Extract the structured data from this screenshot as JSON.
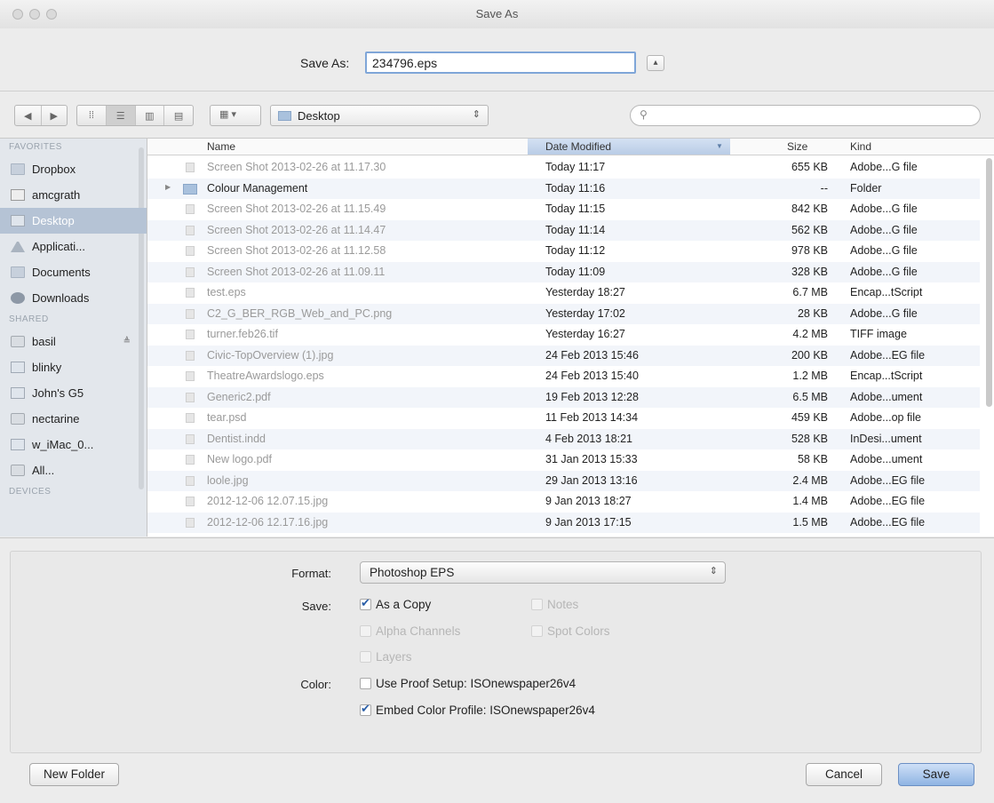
{
  "window": {
    "title": "Save As"
  },
  "save_row": {
    "label": "Save As:",
    "filename": "234796.eps",
    "expand_glyph": "▴"
  },
  "toolbar": {
    "location": "Desktop",
    "search_placeholder": ""
  },
  "sidebar": {
    "sections": [
      {
        "header": "FAVORITES",
        "items": [
          {
            "label": "Dropbox",
            "icon": "folder-icon"
          },
          {
            "label": "amcgrath",
            "icon": "home-icon"
          },
          {
            "label": "Desktop",
            "icon": "desktop-icon",
            "selected": true
          },
          {
            "label": "Applicati...",
            "icon": "applications-icon"
          },
          {
            "label": "Documents",
            "icon": "documents-icon"
          },
          {
            "label": "Downloads",
            "icon": "downloads-icon"
          }
        ]
      },
      {
        "header": "SHARED",
        "items": [
          {
            "label": "basil",
            "icon": "server-icon",
            "eject": "≜"
          },
          {
            "label": "blinky",
            "icon": "computer-icon"
          },
          {
            "label": "John's G5",
            "icon": "computer-icon"
          },
          {
            "label": "nectarine",
            "icon": "server-icon"
          },
          {
            "label": "w_iMac_0...",
            "icon": "computer-icon"
          },
          {
            "label": "All...",
            "icon": "network-icon"
          }
        ]
      },
      {
        "header": "DEVICES",
        "items": []
      }
    ]
  },
  "file_list": {
    "columns": [
      "Name",
      "Date Modified",
      "Size",
      "Kind"
    ],
    "rows": [
      {
        "name": "Screen Shot 2013-02-26 at 11.17.30",
        "date": "Today 11:17",
        "size": "655 KB",
        "kind": "Adobe...G file",
        "enabled": false
      },
      {
        "name": "Colour Management",
        "date": "Today 11:16",
        "size": "--",
        "kind": "Folder",
        "enabled": true,
        "folder": true
      },
      {
        "name": "Screen Shot 2013-02-26 at 11.15.49",
        "date": "Today 11:15",
        "size": "842 KB",
        "kind": "Adobe...G file",
        "enabled": false
      },
      {
        "name": "Screen Shot 2013-02-26 at 11.14.47",
        "date": "Today 11:14",
        "size": "562 KB",
        "kind": "Adobe...G file",
        "enabled": false
      },
      {
        "name": "Screen Shot 2013-02-26 at 11.12.58",
        "date": "Today 11:12",
        "size": "978 KB",
        "kind": "Adobe...G file",
        "enabled": false
      },
      {
        "name": "Screen Shot 2013-02-26 at 11.09.11",
        "date": "Today 11:09",
        "size": "328 KB",
        "kind": "Adobe...G file",
        "enabled": false
      },
      {
        "name": "test.eps",
        "date": "Yesterday 18:27",
        "size": "6.7 MB",
        "kind": "Encap...tScript",
        "enabled": false
      },
      {
        "name": "C2_G_BER_RGB_Web_and_PC.png",
        "date": "Yesterday 17:02",
        "size": "28 KB",
        "kind": "Adobe...G file",
        "enabled": false
      },
      {
        "name": "turner.feb26.tif",
        "date": "Yesterday 16:27",
        "size": "4.2 MB",
        "kind": "TIFF image",
        "enabled": false
      },
      {
        "name": "Civic-TopOverview (1).jpg",
        "date": "24 Feb 2013 15:46",
        "size": "200 KB",
        "kind": "Adobe...EG file",
        "enabled": false
      },
      {
        "name": "TheatreAwardslogo.eps",
        "date": "24 Feb 2013 15:40",
        "size": "1.2 MB",
        "kind": "Encap...tScript",
        "enabled": false
      },
      {
        "name": "Generic2.pdf",
        "date": "19 Feb 2013 12:28",
        "size": "6.5 MB",
        "kind": "Adobe...ument",
        "enabled": false
      },
      {
        "name": "tear.psd",
        "date": "11 Feb 2013 14:34",
        "size": "459 KB",
        "kind": "Adobe...op file",
        "enabled": false
      },
      {
        "name": "Dentist.indd",
        "date": "4 Feb 2013 18:21",
        "size": "528 KB",
        "kind": "InDesi...ument",
        "enabled": false
      },
      {
        "name": "New logo.pdf",
        "date": "31 Jan 2013 15:33",
        "size": "58 KB",
        "kind": "Adobe...ument",
        "enabled": false
      },
      {
        "name": "loole.jpg",
        "date": "29 Jan 2013 13:16",
        "size": "2.4 MB",
        "kind": "Adobe...EG file",
        "enabled": false
      },
      {
        "name": "2012-12-06 12.07.15.jpg",
        "date": "9 Jan 2013 18:27",
        "size": "1.4 MB",
        "kind": "Adobe...EG file",
        "enabled": false
      },
      {
        "name": "2012-12-06 12.17.16.jpg",
        "date": "9 Jan 2013 17:15",
        "size": "1.5 MB",
        "kind": "Adobe...EG file",
        "enabled": false
      }
    ]
  },
  "options": {
    "format_label": "Format:",
    "format_value": "Photoshop EPS",
    "save_label": "Save:",
    "as_a_copy": "As a Copy",
    "notes": "Notes",
    "alpha_channels": "Alpha Channels",
    "spot_colors": "Spot Colors",
    "layers": "Layers",
    "color_label": "Color:",
    "use_proof_setup": "Use Proof Setup:  ISOnewspaper26v4",
    "embed_color_profile": "Embed Color Profile:  ISOnewspaper26v4"
  },
  "buttons": {
    "new_folder": "New Folder",
    "cancel": "Cancel",
    "save": "Save"
  },
  "colors": {
    "accent": "#7fa6d8",
    "selection": "#b5c3d5",
    "primary_button": "#8fb4e3"
  }
}
